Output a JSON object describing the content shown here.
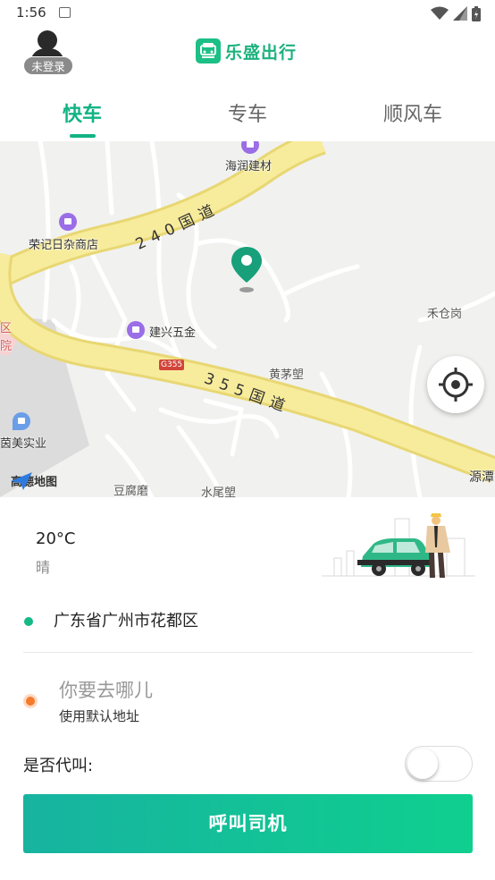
{
  "status_bar": {
    "time": "1:56"
  },
  "header": {
    "avatar_badge": "未登录",
    "brand_name": "乐盛出行",
    "brand_color": "#1cb27e"
  },
  "tabs": [
    {
      "label": "快车",
      "active": true
    },
    {
      "label": "专车",
      "active": false
    },
    {
      "label": "顺风车",
      "active": false
    }
  ],
  "map": {
    "roads": [
      {
        "label": "240国道"
      },
      {
        "label": "355国道"
      }
    ],
    "road_badge": "G355",
    "places": [
      "海润建材",
      "荣记日杂商店",
      "建兴五金",
      "黄茅塱",
      "禾仓岗",
      "茵美实业",
      "豆腐磨",
      "水尾塱",
      "源潭",
      "区",
      "院"
    ],
    "provider": "高德地图"
  },
  "weather": {
    "temperature": "20°C",
    "condition": "晴"
  },
  "origin": {
    "address": "广东省广州市花都区"
  },
  "destination": {
    "placeholder": "你要去哪儿",
    "hint": "使用默认地址"
  },
  "proxy_call": {
    "label": "是否代叫:",
    "enabled": false
  },
  "call_button": {
    "label": "呼叫司机"
  },
  "colors": {
    "accent": "#13b384",
    "origin_dot": "#14b985",
    "destination_dot": "#f57a2c"
  }
}
